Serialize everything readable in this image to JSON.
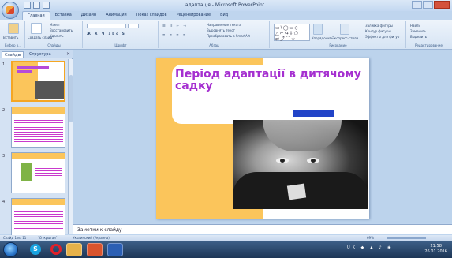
{
  "window": {
    "title": "адаптація - Microsoft PowerPoint"
  },
  "ribbon_tabs": [
    "Главная",
    "Вставка",
    "Дизайн",
    "Анимация",
    "Показ слайдов",
    "Рецензирование",
    "Вид"
  ],
  "ribbon": {
    "clipboard_label": "Буфер о...",
    "paste_label": "Вставить",
    "slides_label": "Слайды",
    "create_slide": "Создать слайд",
    "layout": "Макет",
    "reset": "Восстановить",
    "delete": "Удалить",
    "font_label": "Шрифт",
    "paragraph_label": "Абзац",
    "text_direction": "Направление текста",
    "align_text": "Выровнять текст",
    "convert_smartart": "Преобразовать в SmartArt",
    "drawing_label": "Рисование",
    "arrange": "Упорядочить",
    "quick_styles": "Экспресс-стили",
    "shape_fill": "Заливка фигуры",
    "shape_outline": "Контур фигуры",
    "shape_effects": "Эффекты для фигур",
    "editing_label": "Редактирование",
    "find": "Найти",
    "replace": "Заменить",
    "select": "Выделить"
  },
  "left_panel": {
    "tab_slides": "Слайды",
    "tab_outline": "Структура",
    "slide_numbers": [
      "1",
      "2",
      "3",
      "4"
    ]
  },
  "slide": {
    "title": "Період адаптації в дитячому садку"
  },
  "notes_placeholder": "Заметки к слайду",
  "status": {
    "slide_counter": "Слайд 1 из 11",
    "theme": "\"Открытая\"",
    "language": "Украинский (Украина)",
    "zoom": "69%"
  },
  "taskbar": {
    "time": "21:58",
    "date": "26.01.2016",
    "lang": "UK"
  }
}
